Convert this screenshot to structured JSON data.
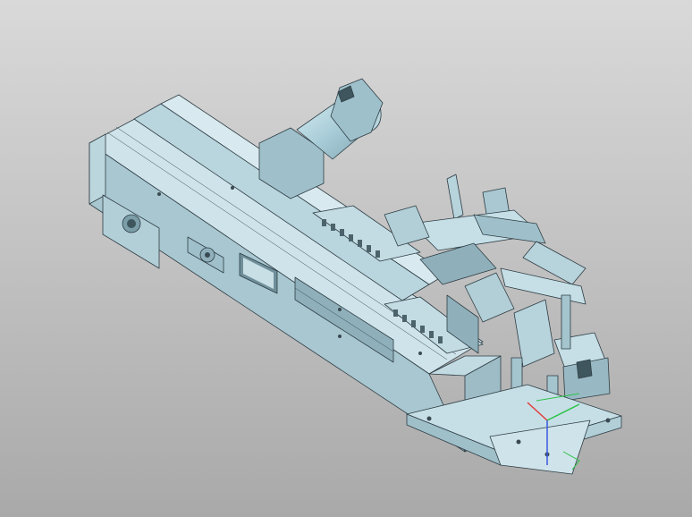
{
  "viewer": {
    "background_top": "#d9d9d9",
    "background_bottom": "#a9a9a9"
  },
  "model": {
    "body_color": "#b7d3dc",
    "body_light": "#cfe3ea",
    "body_dark": "#8fb0bb",
    "edge_color": "#2f3d44",
    "motor_color": "#a9cdd8"
  },
  "triad": {
    "x_color": "#e23b3b",
    "y_color": "#2fc24a",
    "z_color": "#3a56e0"
  }
}
